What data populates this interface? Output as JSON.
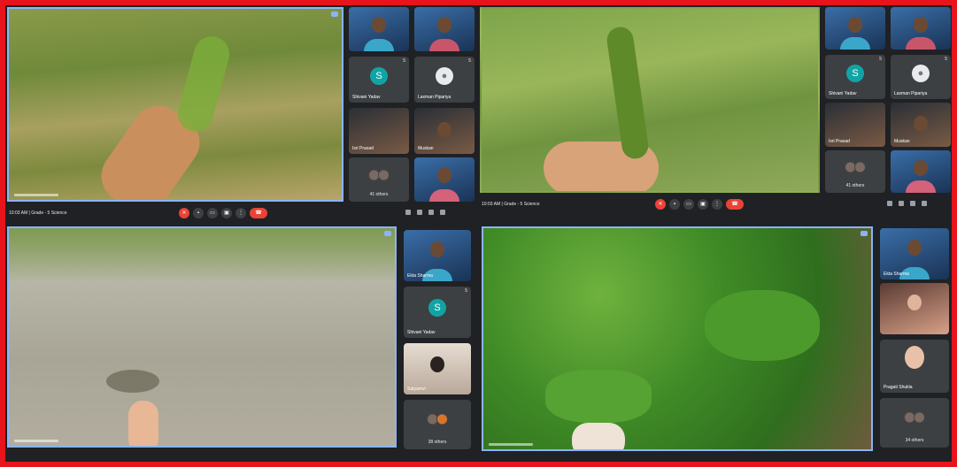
{
  "q1": {
    "meeting_info": "10:03 AM | Grade - 5 Science",
    "tiles": [
      {
        "name": ""
      },
      {
        "name": ""
      },
      {
        "avatar_letter": "S",
        "name": "Shivani Yadav",
        "count": "5"
      },
      {
        "name": "Laxman Pipariya",
        "count": "5"
      },
      {
        "name": "Isri Prasad"
      },
      {
        "name": "Muskan"
      },
      {
        "others": "41 others"
      },
      {
        "name": ""
      }
    ]
  },
  "q2": {
    "meeting_info": "10:03 AM | Grade - 5 Science",
    "tiles": [
      {
        "name": ""
      },
      {
        "name": ""
      },
      {
        "avatar_letter": "S",
        "name": "Shivani Yadav",
        "count": "5"
      },
      {
        "name": "Laxman Pipariya",
        "count": "5"
      },
      {
        "name": "Isri Prasad"
      },
      {
        "name": "Muskan"
      },
      {
        "others": "41 others"
      },
      {
        "name": ""
      }
    ]
  },
  "q3": {
    "tiles": [
      {
        "name": "Ekta Sharma"
      },
      {
        "avatar_letter": "S",
        "name": "Shivani Yadav",
        "count": "5"
      },
      {
        "name": "Satyamvi"
      },
      {
        "others": "38 others"
      }
    ]
  },
  "q4": {
    "tiles": [
      {
        "name": "Ekta Sharma"
      },
      {
        "name": ""
      },
      {
        "name": "Pragati Shukla"
      },
      {
        "others": "34 others"
      }
    ]
  }
}
